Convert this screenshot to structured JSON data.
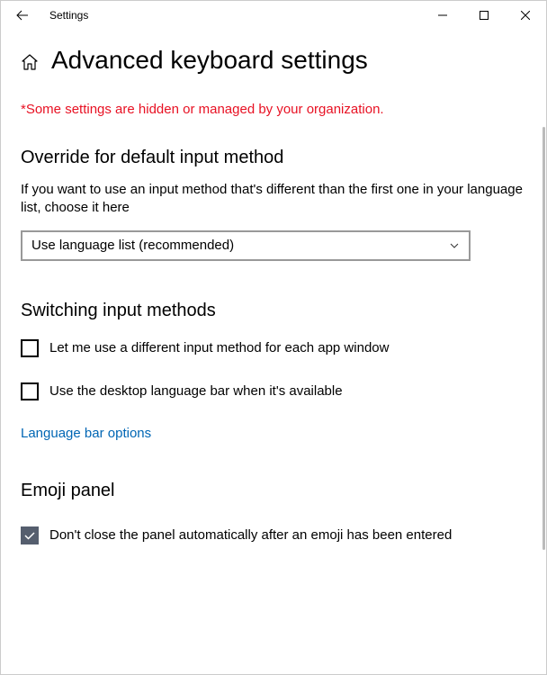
{
  "titlebar": {
    "app_title": "Settings"
  },
  "page": {
    "title": "Advanced keyboard settings",
    "warning": "*Some settings are hidden or managed by your organization."
  },
  "override_section": {
    "heading": "Override for default input method",
    "description": "If you want to use an input method that's different than the first one in your language list, choose it here",
    "dropdown_value": "Use language list (recommended)"
  },
  "switching_section": {
    "heading": "Switching input methods",
    "checkbox1_label": "Let me use a different input method for each app window",
    "checkbox2_label": "Use the desktop language bar when it's available",
    "link": "Language bar options"
  },
  "emoji_section": {
    "heading": "Emoji panel",
    "checkbox_label": "Don't close the panel automatically after an emoji has been entered"
  }
}
